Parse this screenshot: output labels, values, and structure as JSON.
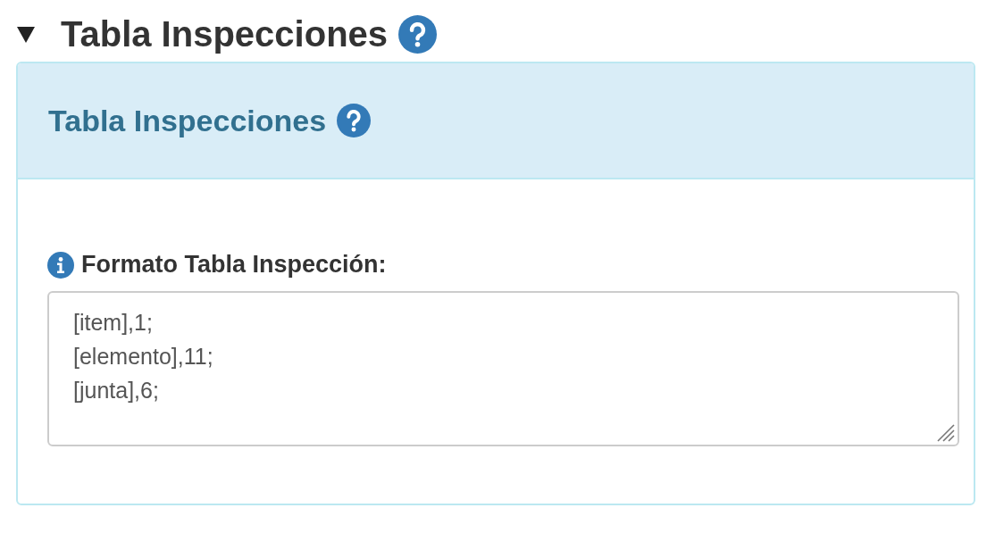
{
  "section": {
    "title": "Tabla Inspecciones",
    "expanded": true
  },
  "panel": {
    "title": "Tabla Inspecciones",
    "field": {
      "label": "Formato Tabla Inspección:",
      "value": "[item],1;\n[elemento],11;\n[junta],6;"
    }
  }
}
